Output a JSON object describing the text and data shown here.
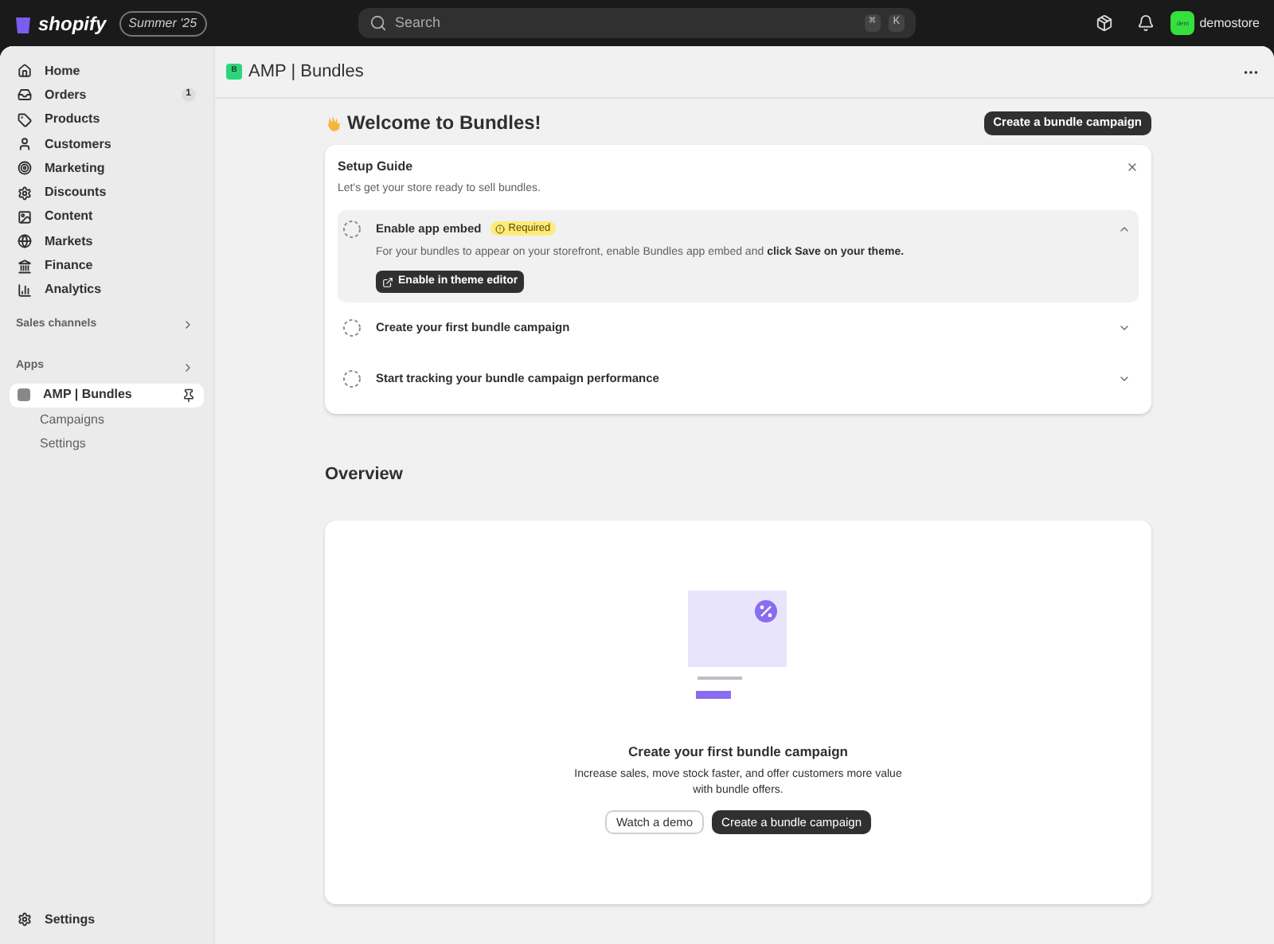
{
  "topbar": {
    "brand": "shopify",
    "edition": "Summer '25",
    "search": {
      "placeholder": "Search"
    },
    "shortcut_keys": [
      "⌘",
      "K"
    ],
    "store": {
      "avatar": "dem",
      "name": "demostore"
    }
  },
  "sidebar": {
    "items": [
      {
        "label": "Home",
        "selected": false
      },
      {
        "label": "Orders",
        "badge": "1",
        "selected": false
      },
      {
        "label": "Products",
        "selected": false
      },
      {
        "label": "Customers",
        "selected": false
      },
      {
        "label": "Marketing",
        "selected": false
      },
      {
        "label": "Discounts",
        "selected": false
      },
      {
        "label": "Content",
        "selected": false
      },
      {
        "label": "Markets",
        "selected": false
      },
      {
        "label": "Finance",
        "selected": false
      },
      {
        "label": "Analytics",
        "selected": false
      }
    ],
    "sections": [
      {
        "label": "Sales channels"
      },
      {
        "label": "Apps"
      }
    ],
    "app": {
      "label": "AMP | Bundles",
      "selected": true,
      "children": [
        {
          "label": "Campaigns",
          "selected": false
        },
        {
          "label": "Settings",
          "selected": false
        }
      ]
    },
    "footer": {
      "label": "Settings"
    }
  },
  "app_header": {
    "logo": "B",
    "title": "AMP | Bundles"
  },
  "page": {
    "title": "Welcome to Bundles!",
    "primary_action": "Create a bundle campaign"
  },
  "setup_guide": {
    "title": "Setup Guide",
    "subtitle": "Let's get your store ready to sell bundles.",
    "steps": [
      {
        "title": "Enable app embed",
        "badge": "Required",
        "description": "For your bundles to appear on your storefront, enable Bundles app embed and **click Save on your theme.**",
        "action": "Enable in theme editor",
        "expanded": true
      },
      {
        "title": "Create your first bundle campaign",
        "expanded": false
      },
      {
        "title": "Start tracking your bundle campaign performance",
        "expanded": false
      }
    ]
  },
  "overview": {
    "heading": "Overview",
    "empty_state": {
      "title": "Create your first bundle campaign",
      "text": "Increase sales, move stock faster, and offer customers more value with bundle offers.",
      "secondary_action": "Watch a demo",
      "primary_action": "Create a bundle campaign"
    }
  }
}
